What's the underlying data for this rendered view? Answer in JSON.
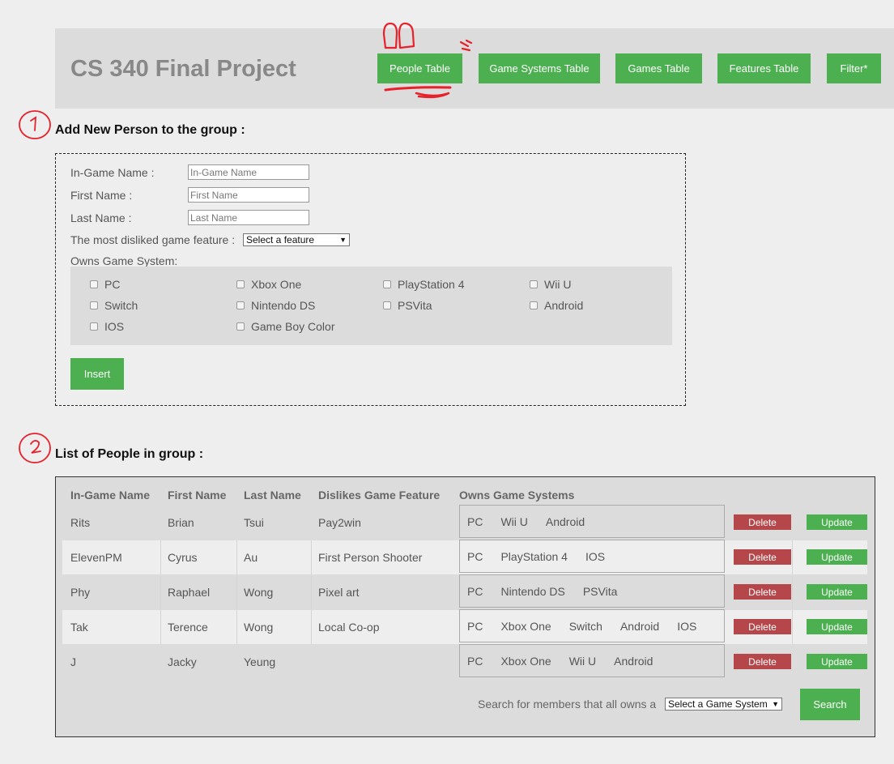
{
  "header": {
    "title": "CS 340 Final Project",
    "nav": [
      "People Table",
      "Game Systems Table",
      "Games Table",
      "Features Table",
      "Filter*"
    ]
  },
  "add_section": {
    "title": "Add New Person to the group :",
    "ingame_label": "In-Game Name :",
    "ingame_placeholder": "In-Game Name",
    "first_label": "First Name :",
    "first_placeholder": "First Name",
    "last_label": "Last Name :",
    "last_placeholder": "Last Name",
    "feature_label": "The most disliked game feature :",
    "feature_select": "Select a feature",
    "owns_label": "Owns Game System:",
    "systems": [
      "PC",
      "Xbox One",
      "PlayStation 4",
      "Wii U",
      "Switch",
      "Nintendo DS",
      "PSVita",
      "Android",
      "IOS",
      "Game Boy Color"
    ],
    "insert_label": "Insert"
  },
  "list_section": {
    "title": "List of People in group :",
    "columns": [
      "In-Game Name",
      "First Name",
      "Last Name",
      "Dislikes Game Feature",
      "Owns Game Systems"
    ],
    "rows": [
      {
        "ingame": "Rits",
        "first": "Brian",
        "last": "Tsui",
        "feature": "Pay2win",
        "systems": [
          "PC",
          "Wii U",
          "Android"
        ]
      },
      {
        "ingame": "ElevenPM",
        "first": "Cyrus",
        "last": "Au",
        "feature": "First Person Shooter",
        "systems": [
          "PC",
          "PlayStation 4",
          "IOS"
        ]
      },
      {
        "ingame": "Phy",
        "first": "Raphael",
        "last": "Wong",
        "feature": "Pixel art",
        "systems": [
          "PC",
          "Nintendo DS",
          "PSVita"
        ]
      },
      {
        "ingame": "Tak",
        "first": "Terence",
        "last": "Wong",
        "feature": "Local Co-op",
        "systems": [
          "PC",
          "Xbox One",
          "Switch",
          "Android",
          "IOS"
        ]
      },
      {
        "ingame": "J",
        "first": "Jacky",
        "last": "Yeung",
        "feature": "",
        "systems": [
          "PC",
          "Xbox One",
          "Wii U",
          "Android"
        ]
      }
    ],
    "delete_label": "Delete",
    "update_label": "Update",
    "search_label": "Search for members that all owns a",
    "search_select": "Select a Game System",
    "search_button": "Search"
  },
  "annotations": {
    "marks": [
      "1",
      "2"
    ],
    "color": "#e8202a"
  },
  "colors": {
    "accent": "#4caf50",
    "danger": "#b5474b",
    "header_bg": "#dcdcdc",
    "page_bg": "#eeeeee"
  }
}
